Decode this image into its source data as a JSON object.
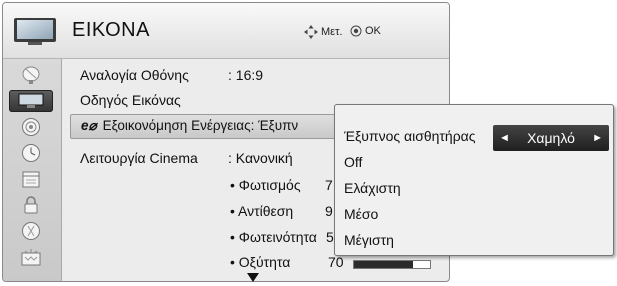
{
  "header": {
    "title": "ΕΙΚΟΝΑ",
    "move_hint": "Μετ.",
    "ok_hint": "OK",
    "move_icon": "four-way-arrow-icon",
    "ok_icon": "ok-button-icon"
  },
  "sidebar": {
    "items": [
      {
        "icon": "satellite-dish-icon"
      },
      {
        "icon": "picture-tv-icon",
        "active": true
      },
      {
        "icon": "audio-speaker-icon"
      },
      {
        "icon": "clock-icon"
      },
      {
        "icon": "calendar-option-icon"
      },
      {
        "icon": "lock-icon"
      },
      {
        "icon": "network-globe-icon"
      },
      {
        "icon": "input-tv-icon"
      }
    ]
  },
  "menu": {
    "aspect_label": "Αναλογία Οθόνης",
    "aspect_value": ": 16:9",
    "wizard_label": "Οδηγός Εικόνας",
    "energy_label": "Εξοικονόμηση Ενέργειας: Έξυπν",
    "cinema_label": "Λειτουργία Cinema",
    "cinema_value": ": Κανονική",
    "sub_items": [
      {
        "label": "• Φωτισμός",
        "value": "7"
      },
      {
        "label": "• Αντίθεση",
        "value": "9"
      },
      {
        "label": "• Φωτεινότητα",
        "value": "5"
      },
      {
        "label": "• Οξύτητα",
        "value": "70"
      }
    ],
    "sharpness_level": 0.78,
    "more_icon": "down-triangle-icon"
  },
  "popup": {
    "sensor_label": "Έξυπνος αισθητήρας",
    "selected_value": "Χαμηλό",
    "left_arrow": "◄",
    "right_arrow": "►",
    "options": [
      "Off",
      "Ελάχιστη",
      "Μέσο",
      "Μέγιστη"
    ]
  },
  "colors": {
    "highlight_dark": "#2b2b2b",
    "panel_bg": "#ececec"
  }
}
